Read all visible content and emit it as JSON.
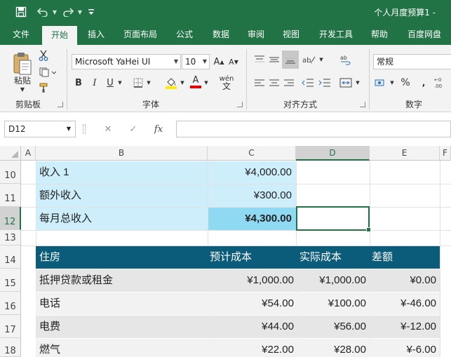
{
  "app": {
    "doc_title": "个人月度预算1 -",
    "qat": {
      "save_icon": "save-icon",
      "undo_icon": "undo-icon",
      "redo_icon": "redo-icon",
      "customize_icon": "customize-qat-icon"
    }
  },
  "tabs": [
    {
      "label": "文件"
    },
    {
      "label": "开始"
    },
    {
      "label": "插入"
    },
    {
      "label": "页面布局"
    },
    {
      "label": "公式"
    },
    {
      "label": "数据"
    },
    {
      "label": "审阅"
    },
    {
      "label": "视图"
    },
    {
      "label": "开发工具"
    },
    {
      "label": "帮助"
    },
    {
      "label": "百度网盘"
    }
  ],
  "active_tab": "开始",
  "ribbon": {
    "clipboard": {
      "label": "剪贴板",
      "paste_label": "粘贴"
    },
    "font": {
      "label": "字体",
      "font_name": "Microsoft YaHei UI",
      "font_size": "10",
      "bold": "B",
      "italic": "I",
      "underline": "U",
      "grow": "A",
      "shrink": "A",
      "font_color_letter": "A",
      "phonetic": "wén"
    },
    "alignment": {
      "label": "对齐方式"
    },
    "number": {
      "label": "数字",
      "format": "常规",
      "percent": "%"
    }
  },
  "formula_bar": {
    "name_box": "D12",
    "cancel": "✕",
    "enter": "✓",
    "fx": "fx",
    "value": ""
  },
  "grid": {
    "columns": [
      "A",
      "B",
      "C",
      "D",
      "E",
      "F"
    ],
    "selected_column": "D",
    "rows": [
      "10",
      "11",
      "12",
      "13",
      "14",
      "15",
      "16",
      "17",
      "18"
    ],
    "selected_row": "12",
    "selected_cell": "D12",
    "income": [
      {
        "label": "收入 1",
        "amount": "¥4,000.00"
      },
      {
        "label": "额外收入",
        "amount": "¥300.00"
      },
      {
        "label": "每月总收入",
        "amount": "¥4,300.00"
      }
    ],
    "housing_header": {
      "category": "住房",
      "projected": "预计成本",
      "actual": "实际成本",
      "diff": "差额"
    },
    "housing_rows": [
      {
        "item": "抵押贷款或租金",
        "projected": "¥1,000.00",
        "actual": "¥1,000.00",
        "diff": "¥0.00"
      },
      {
        "item": "电话",
        "projected": "¥54.00",
        "actual": "¥100.00",
        "diff": "¥-46.00"
      },
      {
        "item": "电费",
        "projected": "¥44.00",
        "actual": "¥56.00",
        "diff": "¥-12.00"
      },
      {
        "item": "燃气",
        "projected": "¥22.00",
        "actual": "¥28.00",
        "diff": "¥-6.00"
      }
    ]
  },
  "colors": {
    "excel_green": "#217346",
    "income_fill": "#cdeefa",
    "total_fill": "#8fd9f3",
    "header_fill": "#0b5b7a",
    "row_band": "#e6e6e6"
  }
}
